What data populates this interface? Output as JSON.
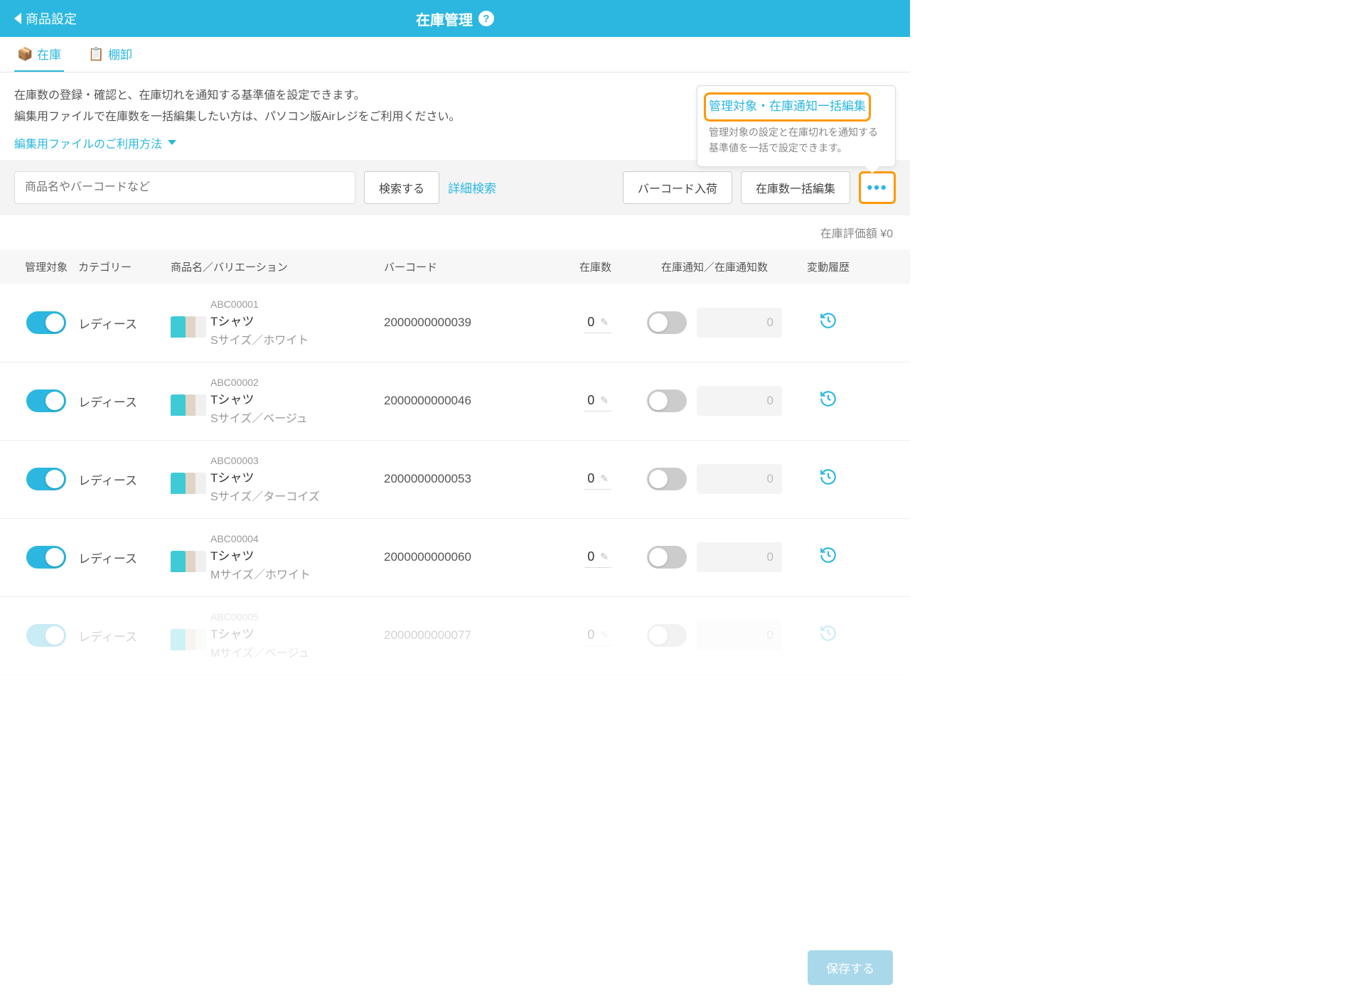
{
  "header": {
    "back": "商品設定",
    "title": "在庫管理"
  },
  "tabs": {
    "stock": "在庫",
    "inventory": "棚卸"
  },
  "intro": {
    "line1": "在庫数の登録・確認と、在庫切れを通知する基準値を設定できます。",
    "line2": "編集用ファイルで在庫数を一括編集したい方は、パソコン版Airレジをご利用ください。",
    "link": "編集用ファイルのご利用方法"
  },
  "tooltip": {
    "title": "管理対象・在庫通知一括編集",
    "desc": "管理対象の設定と在庫切れを通知する基準値を一括で設定できます。"
  },
  "search": {
    "placeholder": "商品名やバーコードなど",
    "search_btn": "検索する",
    "advanced": "詳細検索",
    "barcode_in": "バーコード入荷",
    "bulk_stock": "在庫数一括編集"
  },
  "summary": "在庫評価額  ¥0",
  "columns": {
    "target": "管理対象",
    "category": "カテゴリー",
    "name": "商品名／バリエーション",
    "barcode": "バーコード",
    "stock": "在庫数",
    "notify": "在庫通知／在庫通知数",
    "history": "変動履歴"
  },
  "rows": [
    {
      "cat": "レディース",
      "sku": "ABC00001",
      "name": "Tシャツ",
      "var": "Sサイズ／ホワイト",
      "barcode": "2000000000039",
      "stock": "0",
      "notify": "0"
    },
    {
      "cat": "レディース",
      "sku": "ABC00002",
      "name": "Tシャツ",
      "var": "Sサイズ／ベージュ",
      "barcode": "2000000000046",
      "stock": "0",
      "notify": "0"
    },
    {
      "cat": "レディース",
      "sku": "ABC00003",
      "name": "Tシャツ",
      "var": "Sサイズ／ターコイズ",
      "barcode": "2000000000053",
      "stock": "0",
      "notify": "0"
    },
    {
      "cat": "レディース",
      "sku": "ABC00004",
      "name": "Tシャツ",
      "var": "Mサイズ／ホワイト",
      "barcode": "2000000000060",
      "stock": "0",
      "notify": "0"
    },
    {
      "cat": "レディース",
      "sku": "ABC00005",
      "name": "Tシャツ",
      "var": "Mサイズ／ベージュ",
      "barcode": "2000000000077",
      "stock": "0",
      "notify": "0"
    }
  ],
  "footer": {
    "save": "保存する"
  }
}
